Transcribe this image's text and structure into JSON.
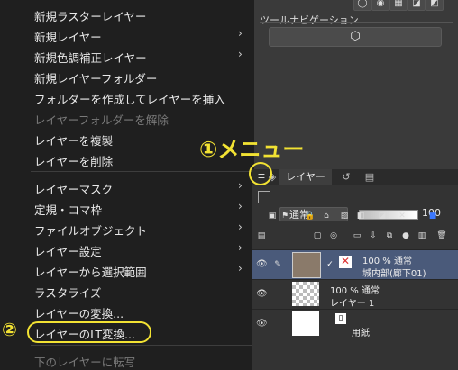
{
  "tool_navigation": {
    "title": "ツールナビゲーション",
    "button_icon": "navigation-icon"
  },
  "context_menu": {
    "items": [
      {
        "label": "新規ラスターレイヤー",
        "has_submenu": false,
        "disabled": false
      },
      {
        "label": "新規レイヤー",
        "has_submenu": true,
        "disabled": false
      },
      {
        "label": "新規色調補正レイヤー",
        "has_submenu": true,
        "disabled": false
      },
      {
        "label": "新規レイヤーフォルダー",
        "has_submenu": false,
        "disabled": false
      },
      {
        "label": "フォルダーを作成してレイヤーを挿入",
        "has_submenu": false,
        "disabled": false
      },
      {
        "label": "レイヤーフォルダーを解除",
        "has_submenu": false,
        "disabled": true
      },
      {
        "label": "レイヤーを複製",
        "has_submenu": false,
        "disabled": false
      },
      {
        "label": "レイヤーを削除",
        "has_submenu": false,
        "disabled": false
      },
      {
        "label": "レイヤーマスク",
        "has_submenu": true,
        "disabled": false
      },
      {
        "label": "定規・コマ枠",
        "has_submenu": true,
        "disabled": false
      },
      {
        "label": "ファイルオブジェクト",
        "has_submenu": true,
        "disabled": false
      },
      {
        "label": "レイヤー設定",
        "has_submenu": true,
        "disabled": false
      },
      {
        "label": "レイヤーから選択範囲",
        "has_submenu": true,
        "disabled": false
      },
      {
        "label": "ラスタライズ",
        "has_submenu": false,
        "disabled": false
      },
      {
        "label": "レイヤーの変換...",
        "has_submenu": false,
        "disabled": false
      },
      {
        "label": "レイヤーのLT変換...",
        "has_submenu": false,
        "disabled": false
      },
      {
        "label": "下のレイヤーに転写",
        "has_submenu": false,
        "disabled": true
      }
    ],
    "submenu_arrow": "›"
  },
  "annotations": {
    "menu_callout": "①メニュー",
    "lt_callout": "②"
  },
  "layer_panel": {
    "menu_icon": "≡",
    "tab_label": "レイヤー",
    "blend_mode": "通常",
    "opacity": "100",
    "layers": [
      {
        "line1": "100 % 通常",
        "line2": "城内部(廊下01)",
        "selected": true
      },
      {
        "line1": "100 % 通常",
        "line2": "レイヤー 1",
        "selected": false
      },
      {
        "line1": "",
        "line2": "用紙",
        "selected": false
      }
    ]
  }
}
